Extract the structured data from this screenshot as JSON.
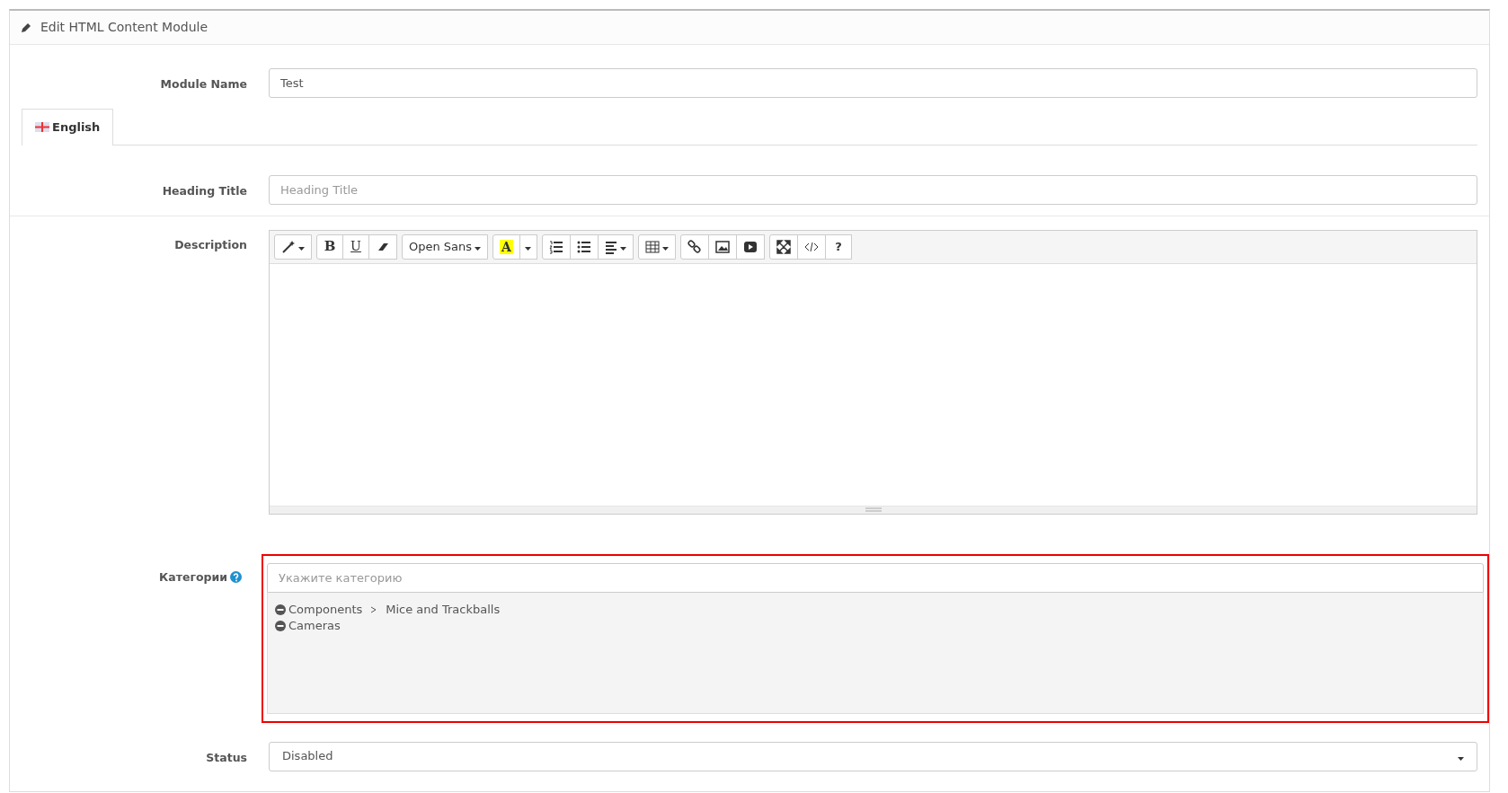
{
  "panel": {
    "title": "Edit HTML Content Module"
  },
  "module_name": {
    "label": "Module Name",
    "value": "Test"
  },
  "tabs": [
    {
      "label": "English",
      "selected": true
    }
  ],
  "heading_title": {
    "label": "Heading Title",
    "placeholder": "Heading Title"
  },
  "description": {
    "label": "Description",
    "toolbar": [
      [
        {
          "kind": "style"
        }
      ],
      [
        {
          "kind": "bold",
          "label": "B"
        },
        {
          "kind": "underline",
          "label": "U"
        },
        {
          "kind": "eraser"
        }
      ],
      [
        {
          "kind": "font",
          "label": "Open Sans"
        }
      ],
      [
        {
          "kind": "color",
          "label": "A"
        },
        {
          "kind": "color-caret"
        }
      ],
      [
        {
          "kind": "ol"
        },
        {
          "kind": "ul"
        },
        {
          "kind": "align"
        }
      ],
      [
        {
          "kind": "table"
        }
      ],
      [
        {
          "kind": "link"
        },
        {
          "kind": "picture"
        },
        {
          "kind": "video"
        }
      ],
      [
        {
          "kind": "fullscreen"
        },
        {
          "kind": "code"
        },
        {
          "kind": "help",
          "label": "?"
        }
      ]
    ]
  },
  "categories": {
    "label": "Категории",
    "placeholder": "Укажите категорию",
    "items": [
      {
        "path": [
          "Components",
          "Mice and Trackballs"
        ]
      },
      {
        "path": [
          "Cameras"
        ]
      }
    ]
  },
  "status": {
    "label": "Status",
    "value": "Disabled"
  }
}
